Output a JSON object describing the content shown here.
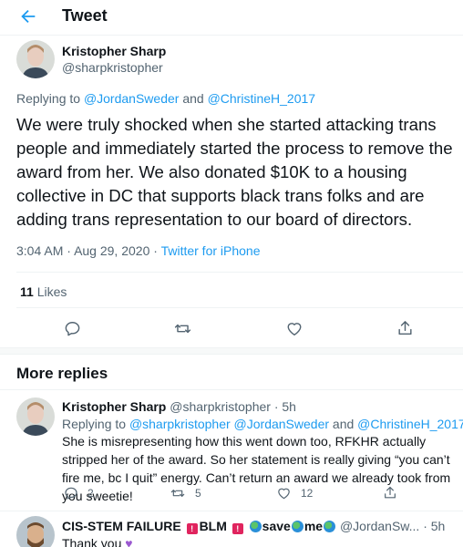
{
  "header": {
    "title": "Tweet"
  },
  "tweet": {
    "author_name": "Kristopher Sharp",
    "author_handle": "@sharpkristopher",
    "replying_prefix": "Replying to",
    "replying_to_1": "@JordanSweder",
    "replying_and": "and",
    "replying_to_2": "@ChristineH_2017",
    "text": "We were truly shocked when she started attacking trans people and immediately started the process to remove the award from her. We also donated $10K to a housing collective in DC that supports black trans folks and are adding trans representation to our board of directors.",
    "time": "3:04 AM",
    "dot": "·",
    "date": "Aug 29, 2020",
    "source": "Twitter for iPhone",
    "likes_count": "11",
    "likes_label": "Likes"
  },
  "more_replies": {
    "title": "More replies"
  },
  "reply1": {
    "name": "Kristopher Sharp",
    "handle": "@sharpkristopher",
    "time": "· 5h",
    "replying_prefix": "Replying to",
    "replying_to": "@sharpkristopher @JordanSweder",
    "replying_and": "and",
    "replying_to_2": "@ChristineH_2017",
    "text": "She is misrepresenting how this went down too, RFKHR actually stripped her of the award. So her statement is really giving “you can’t fire me, bc I quit” energy. Can’t return an award we already took from you sweetie!",
    "reply_count": "2",
    "retweet_count": "5",
    "like_count": "12"
  },
  "reply2": {
    "name_part1": "CIS-STEM FAILURE",
    "name_blm": "BLM",
    "name_save": "save",
    "name_me": "me",
    "handle": "@JordanSw...",
    "time": "· 5h",
    "text": "Thank you"
  },
  "icons": {
    "back": "back-arrow-icon",
    "reply": "reply-icon",
    "retweet": "retweet-icon",
    "like": "heart-icon",
    "share": "share-icon"
  },
  "colors": {
    "accent": "#1d9bf0",
    "text": "#0f1419",
    "secondary": "#536471"
  }
}
